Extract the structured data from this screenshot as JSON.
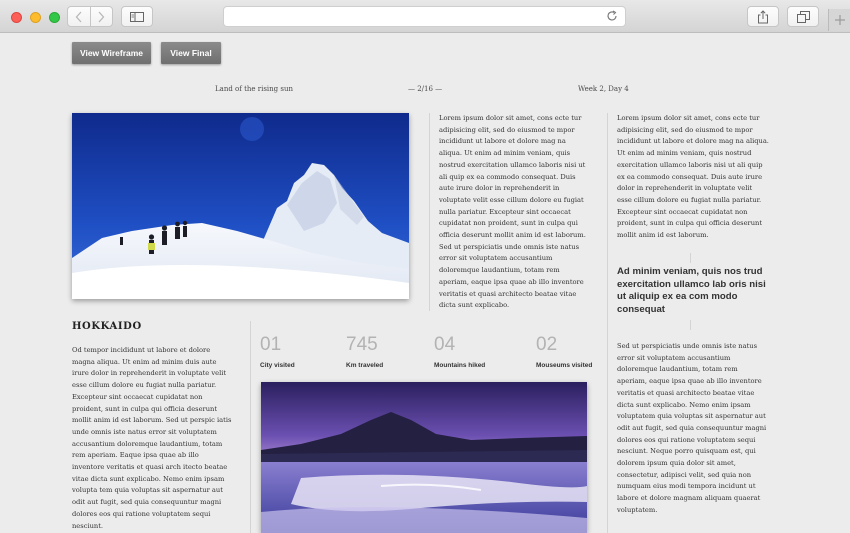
{
  "browser": {
    "buttons": {
      "back": "back-icon",
      "forward": "forward-icon",
      "sidebar": "sidebar-icon",
      "share": "share-icon",
      "tabs": "tabs-icon",
      "reload": "reload-icon",
      "new_tab": "plus-icon"
    }
  },
  "toolbar": {
    "wireframe_label": "View Wireframe",
    "final_label": "View Final"
  },
  "header": {
    "left": "Land of the rising sun",
    "center": "— 2/16 —",
    "right": "Week 2, Day 4"
  },
  "columns": {
    "middle_text": "Lorem ipsum dolor sit amet, cons ecte tur adipisicing elit, sed do eiusmod te mpor incididunt ut labore et dolore mag na aliqua. Ut enim ad minim veniam, quis nostrud exercitation ullamco laboris nisi ut ali quip ex ea commodo consequat. Duis aute irure dolor in reprehenderit in voluptate velit esse cillum dolore eu fugiat nulla pariatur. Excepteur sint occaecat cupidatat non proident, sunt in culpa qui officia deserunt mollit anim id est laborum. Sed ut perspiciatis unde omnis iste natus error sit voluptatem accusantium doloremque laudantium, totam rem aperiam, eaque ipsa quae ab illo inventore veritatis et quasi architecto beatae vitae dicta sunt explicabo.",
    "right_text_1": "Lorem ipsum dolor sit amet, cons ecte tur adipisicing elit, sed do eiusmod te mpor incididunt ut labore et dolore mag na aliqua. Ut enim ad minim veniam, quis nostrud exercitation ullamco laboris nisi ut ali quip ex ea commodo consequat. Duis aute irure dolor in reprehenderit in voluptate velit esse cillum dolore eu fugiat nulla pariatur. Excepteur sint occaecat cupidatat non proident, sunt in culpa qui officia deserunt mollit anim id est laborum.",
    "quote": "Ad minim veniam, quis nos trud exercitation ullamco lab oris nisi ut aliquip ex ea com modo consequat",
    "right_text_2": "Sed ut perspiciatis unde omnis iste natus error sit voluptatem accusantium doloremque laudantium, totam rem aperiam, eaque ipsa quae ab illo inventore veritatis et quasi architecto beatae vitae dicta sunt explicabo. Nemo enim ipsam voluptatem quia voluptas sit aspernatur aut odit aut fugit, sed quia consequuntur magni dolores eos qui ratione voluptatem sequi nesciunt. Neque porro quisquam est, qui dolorem ipsum quia dolor sit amet, consectetur, adipisci velit, sed quia non numquam eius modi tempora incidunt ut labore et dolore magnam aliquam quaerat voluptatem."
  },
  "section": {
    "title": "HOKKAIDO",
    "text": "Od tempor incididunt ut labore et dolore magna aliqua. Ut enim ad minim duis aute irure dolor in reprehenderit in voluptate velit esse cillum dolore eu fugiat nulla pariatur. Excepteur sint occaecat cupidatat non proident, sunt in culpa qui officia deserunt mollit anim id est laborum. Sed ut perspic iatis unde omnis iste natus error sit voluptatem accusantium doloremque laudantium, totam rem aperiam. Eaque ipsa quae ab illo inventore veritatis et quasi arch itecto beatae vitae dicta sunt explicabo. Nemo enim ipsam volupta tem quia voluptas sit aspernatur aut odit aut fugit, sed quia consequuntur magni dolores eos qui ratione voluptatem sequi nesciunt."
  },
  "stats": [
    {
      "value": "01",
      "label": "City visited"
    },
    {
      "value": "745",
      "label": "Km traveled"
    },
    {
      "value": "04",
      "label": "Mountains hiked"
    },
    {
      "value": "02",
      "label": "Mouseums visited"
    }
  ],
  "images": {
    "photo1": "snowy-mountain-hikers-photo",
    "photo2": "purple-dusk-volcano-lake-photo"
  }
}
